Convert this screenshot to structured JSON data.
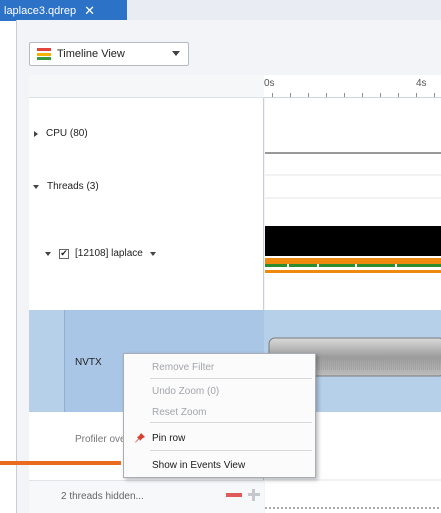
{
  "tab": {
    "title": "laplace3.qdrep",
    "close_glyph": "✕"
  },
  "toolbar": {
    "view_select": "Timeline View"
  },
  "ruler": {
    "labels": [
      "0s",
      "4s"
    ]
  },
  "rows": {
    "cpu": "CPU (80)",
    "threads": "Threads (3)",
    "thread": "[12108] laplace",
    "nvtx": "NVTX",
    "profiler": "Profiler ove",
    "hidden": "2 threads hidden..."
  },
  "context_menu": {
    "items": [
      {
        "label": "Remove Filter",
        "enabled": false
      },
      {
        "label": "Undo Zoom (0)",
        "enabled": false
      },
      {
        "label": "Reset Zoom",
        "enabled": false
      },
      {
        "label": "Pin row",
        "enabled": true
      },
      {
        "label": "Show in Events View",
        "enabled": true
      }
    ]
  },
  "colors": {
    "accent": "#2c72c7",
    "selection": "#b6d0ea",
    "pointer": "#ea6b1f",
    "thread_bar": "#000000",
    "thread_orange": "#f08a0e",
    "thread_green": "#2c8d2e",
    "remove": "#e05a5a"
  },
  "icons": {
    "timeline_view": "timeline-view-icon",
    "pin": "pin-icon",
    "remove": "minus-icon",
    "add": "plus-icon"
  }
}
